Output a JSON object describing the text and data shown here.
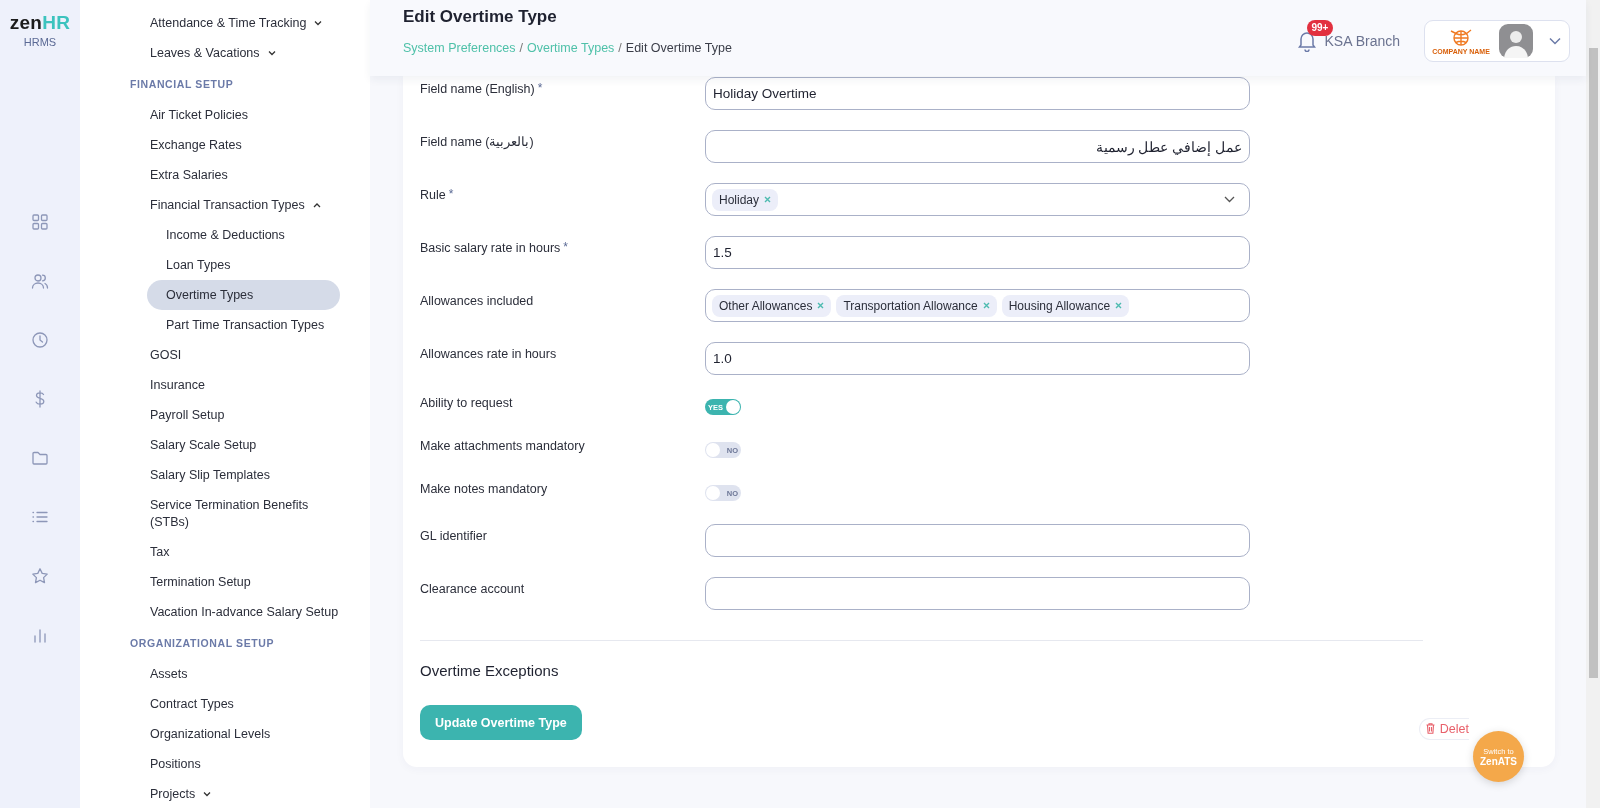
{
  "brand": {
    "logo_main": "zen",
    "logo_accent": "HR",
    "product": "HRMS"
  },
  "rail": {
    "items": [
      {
        "selected": false
      },
      {
        "selected": false
      },
      {
        "selected": false
      },
      {
        "selected": false
      },
      {
        "selected": false
      },
      {
        "selected": false
      },
      {
        "selected": false
      },
      {
        "selected": false
      }
    ]
  },
  "sidebar": {
    "groups": [
      {
        "items": [
          {
            "label": "Attendance & Time Tracking",
            "selected": false,
            "expanded": false,
            "expandable": true
          },
          {
            "label": "Leaves & Vacations",
            "selected": false,
            "expanded": false,
            "expandable": true
          }
        ]
      },
      {
        "heading": "FINANCIAL SETUP",
        "items": [
          {
            "label": "Air Ticket Policies",
            "selected": false
          },
          {
            "label": "Exchange Rates",
            "selected": false
          },
          {
            "label": "Extra Salaries",
            "selected": false
          },
          {
            "label": "Financial Transaction Types",
            "selected": false,
            "expanded": true,
            "expandable": true,
            "children": [
              {
                "label": "Income & Deductions",
                "selected": false
              },
              {
                "label": "Loan Types",
                "selected": false
              },
              {
                "label": "Overtime Types",
                "selected": true
              },
              {
                "label": "Part Time Transaction Types",
                "selected": false
              }
            ]
          },
          {
            "label": "GOSI",
            "selected": false
          },
          {
            "label": "Insurance",
            "selected": false
          },
          {
            "label": "Payroll Setup",
            "selected": false
          },
          {
            "label": "Salary Scale Setup",
            "selected": false
          },
          {
            "label": "Salary Slip Templates",
            "selected": false
          },
          {
            "label": "Service Termination Benefits (STBs)",
            "selected": false
          },
          {
            "label": "Tax",
            "selected": false
          },
          {
            "label": "Termination Setup",
            "selected": false
          },
          {
            "label": "Vacation In-advance Salary Setup",
            "selected": false
          }
        ]
      },
      {
        "heading": "ORGANIZATIONAL SETUP",
        "items": [
          {
            "label": "Assets",
            "selected": false
          },
          {
            "label": "Contract Types",
            "selected": false
          },
          {
            "label": "Organizational Levels",
            "selected": false
          },
          {
            "label": "Positions",
            "selected": false
          },
          {
            "label": "Projects",
            "selected": false,
            "expanded": false,
            "expandable": true
          }
        ]
      }
    ]
  },
  "header": {
    "title": "Edit Overtime Type",
    "breadcrumbs": [
      {
        "label": "System Preferences",
        "link": true
      },
      {
        "separator": "/",
        "label": "Overtime Types",
        "link": true
      },
      {
        "separator": "/",
        "label": "Edit Overtime Type",
        "link": false
      }
    ],
    "notifications": "99+",
    "branch": "KSA Branch",
    "company_logo_text": "COMPANY NAME"
  },
  "form": {
    "fields": [
      {
        "kind": "text",
        "label": "Field name (English)",
        "required_mark": "*",
        "value": "Holiday Overtime"
      },
      {
        "kind": "text",
        "label": "Field name (بالعربية)",
        "value": "عمل إضافي عطل رسمية"
      },
      {
        "kind": "select",
        "label": "Rule",
        "required_mark": "*",
        "tags": [
          "Holiday"
        ]
      },
      {
        "kind": "text",
        "label": "Basic salary rate in hours",
        "required_mark": "*",
        "value": "1.5"
      },
      {
        "kind": "tags",
        "label": "Allowances included",
        "tags": [
          "Other Allowances",
          "Transportation Allowance",
          "Housing Allowance"
        ]
      },
      {
        "kind": "text",
        "label": "Allowances rate in hours",
        "value": "1.0"
      },
      {
        "kind": "toggle",
        "label": "Ability to request",
        "on": true,
        "text": "YES"
      },
      {
        "kind": "toggle",
        "label": "Make attachments mandatory",
        "on": false,
        "text": "NO"
      },
      {
        "kind": "toggle",
        "label": "Make notes mandatory",
        "on": false,
        "text": "NO"
      },
      {
        "kind": "text",
        "label": "GL identifier"
      },
      {
        "kind": "text",
        "label": "Clearance account"
      }
    ]
  },
  "section_title": "Overtime Exceptions",
  "submit": "Update Overtime Type",
  "delete": "Delet",
  "fab": {
    "line1": "Switch to",
    "line2": "ZenATS"
  }
}
